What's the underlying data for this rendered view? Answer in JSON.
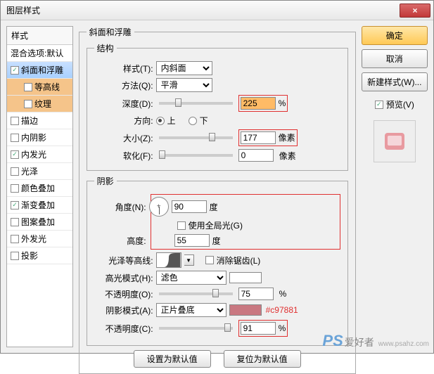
{
  "window": {
    "title": "图层样式",
    "close": "×"
  },
  "styles": {
    "header": "样式",
    "items": [
      {
        "label": "混合选项:默认",
        "checked": null
      },
      {
        "label": "斜面和浮雕",
        "checked": true,
        "sel": true
      },
      {
        "label": "等高线",
        "checked": false,
        "indent": true,
        "hi": true
      },
      {
        "label": "纹理",
        "checked": false,
        "indent": true,
        "hi": true
      },
      {
        "label": "描边",
        "checked": false
      },
      {
        "label": "内阴影",
        "checked": false
      },
      {
        "label": "内发光",
        "checked": true
      },
      {
        "label": "光泽",
        "checked": false
      },
      {
        "label": "颜色叠加",
        "checked": false
      },
      {
        "label": "渐变叠加",
        "checked": true
      },
      {
        "label": "图案叠加",
        "checked": false
      },
      {
        "label": "外发光",
        "checked": false
      },
      {
        "label": "投影",
        "checked": false
      }
    ]
  },
  "panel": {
    "title": "斜面和浮雕",
    "structure": {
      "legend": "结构",
      "style_label": "样式(T):",
      "style_value": "内斜面",
      "technique_label": "方法(Q):",
      "technique_value": "平滑",
      "depth_label": "深度(D):",
      "depth_value": "225",
      "depth_unit": "%",
      "direction_label": "方向:",
      "up": "上",
      "down": "下",
      "size_label": "大小(Z):",
      "size_value": "177",
      "size_unit": "像素",
      "soften_label": "软化(F):",
      "soften_value": "0",
      "soften_unit": "像素"
    },
    "shading": {
      "legend": "阴影",
      "angle_label": "角度(N):",
      "angle_value": "90",
      "angle_unit": "度",
      "global_label": "使用全局光(G)",
      "altitude_label": "高度:",
      "altitude_value": "55",
      "altitude_unit": "度",
      "gloss_label": "光泽等高线:",
      "antialias_label": "消除锯齿(L)",
      "hmode_label": "高光模式(H):",
      "hmode_value": "滤色",
      "hopacity_label": "不透明度(O):",
      "hopacity_value": "75",
      "hopacity_unit": "%",
      "smode_label": "阴影模式(A):",
      "smode_value": "正片叠底",
      "scolor": "#c97881",
      "sopacity_label": "不透明度(C):",
      "sopacity_value": "91",
      "sopacity_unit": "%"
    },
    "footer": {
      "default": "设置为默认值",
      "reset": "复位为默认值"
    }
  },
  "right": {
    "ok": "确定",
    "cancel": "取消",
    "newstyle": "新建样式(W)...",
    "preview_label": "预览(V)"
  },
  "annotation": "#c97881",
  "watermark": {
    "ps": "PS",
    "cn": "爱好者",
    "url": "www.psahz.com"
  }
}
